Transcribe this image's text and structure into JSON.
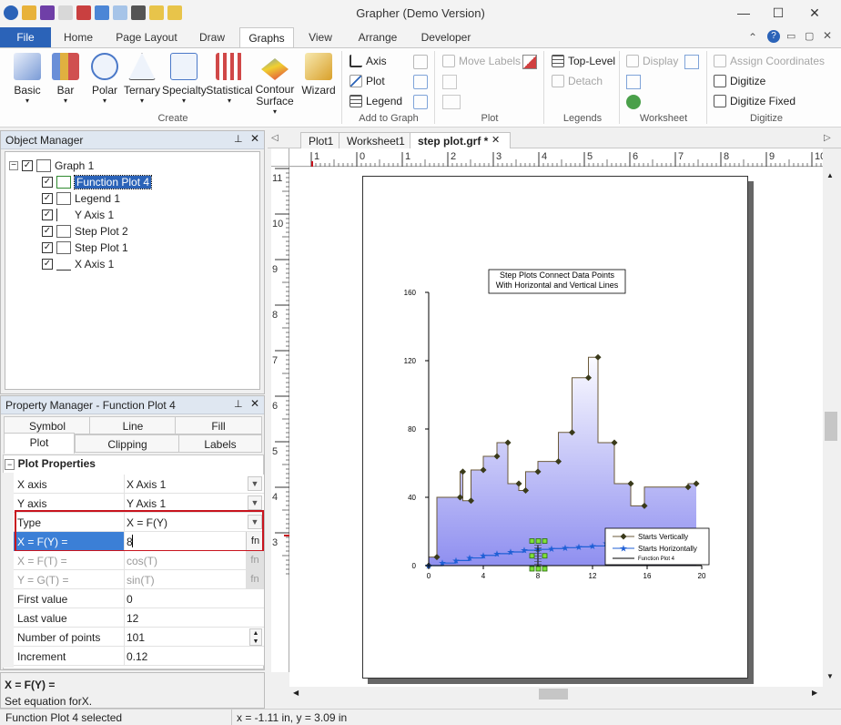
{
  "app": {
    "title": "Grapher (Demo Version)"
  },
  "ribbon_tabs": [
    "File",
    "Home",
    "Page Layout",
    "Draw",
    "Graphs",
    "View",
    "Arrange",
    "Developer"
  ],
  "ribbon": {
    "create": {
      "group": "Create",
      "buttons": [
        "Basic",
        "Bar",
        "Polar",
        "Ternary",
        "Specialty",
        "Statistical",
        "Contour Surface",
        "Wizard"
      ]
    },
    "add_to_graph": {
      "group": "Add to Graph",
      "items": [
        "Axis",
        "Plot",
        "Legend"
      ]
    },
    "plot": {
      "group": "Plot",
      "move_labels": "Move Labels"
    },
    "legends": {
      "group": "Legends",
      "top_level": "Top-Level",
      "detach": "Detach"
    },
    "worksheet": {
      "group": "Worksheet",
      "display": "Display"
    },
    "digitize": {
      "group": "Digitize",
      "assign": "Assign Coordinates",
      "digitize": "Digitize",
      "digitize_fixed": "Digitize Fixed"
    }
  },
  "object_manager": {
    "title": "Object Manager",
    "items": [
      "Graph 1",
      "Function Plot 4",
      "Legend 1",
      "Y Axis 1",
      "Step Plot 2",
      "Step Plot 1",
      "X Axis 1"
    ]
  },
  "property_manager": {
    "title": "Property Manager - Function Plot 4",
    "tabs": [
      "Symbol",
      "Line",
      "Fill",
      "Plot",
      "Clipping",
      "Labels"
    ],
    "section": "Plot Properties",
    "rows": [
      {
        "k": "X axis",
        "v": "X Axis 1"
      },
      {
        "k": "Y axis",
        "v": "Y Axis 1"
      },
      {
        "k": "Type",
        "v": "X = F(Y)"
      },
      {
        "k": "X = F(Y) =",
        "v": "8"
      },
      {
        "k": "X = F(T) =",
        "v": "cos(T)"
      },
      {
        "k": "Y = G(T) =",
        "v": "sin(T)"
      },
      {
        "k": "First value",
        "v": "0"
      },
      {
        "k": "Last value",
        "v": "12"
      },
      {
        "k": "Number of points",
        "v": "101"
      },
      {
        "k": "Increment",
        "v": "0.12"
      }
    ],
    "fn": "fn",
    "desc_title": "X = F(Y) =",
    "desc_text": "Set equation forX."
  },
  "doc_tabs": [
    "Plot1",
    "Worksheet1",
    "step plot.grf *"
  ],
  "ruler_h": [
    "1",
    "0",
    "1",
    "2",
    "3",
    "4",
    "5",
    "6",
    "7",
    "8",
    "9",
    "10"
  ],
  "ruler_v": [
    "11",
    "10",
    "9",
    "8",
    "7",
    "6",
    "5",
    "4",
    "3"
  ],
  "chart_data": {
    "type": "line",
    "title": "Step Plots Connect Data Points\nWith Horizontal and Vertical Lines",
    "title_lines": [
      "Step Plots Connect Data Points",
      "With Horizontal and Vertical Lines"
    ],
    "xlim": [
      0,
      20
    ],
    "ylim": [
      0,
      160
    ],
    "xticks": [
      0,
      4,
      8,
      12,
      16,
      20
    ],
    "yticks": [
      0,
      40,
      80,
      120,
      160
    ],
    "series": [
      {
        "name": "Starts Vertically",
        "x": [
          0,
          0.6,
          2.3,
          2.5,
          3.1,
          4,
          5,
          5.8,
          6.6,
          7.1,
          8,
          9.5,
          10.5,
          11.7,
          12.4,
          13.6,
          14.8,
          15.8,
          19,
          19.6
        ],
        "y": [
          0,
          5,
          40,
          55,
          38,
          56,
          64,
          72,
          48,
          44,
          55,
          61,
          78,
          110,
          122,
          72,
          48,
          35,
          46,
          48
        ]
      },
      {
        "name": "Starts Horizontally",
        "x": [
          0,
          1,
          2,
          3,
          4,
          5,
          6,
          7,
          8,
          9,
          10,
          11,
          12,
          13
        ],
        "y": [
          0,
          1.5,
          3,
          4.5,
          6,
          7,
          8,
          9,
          9.5,
          10,
          10.5,
          11,
          11.5,
          13
        ]
      },
      {
        "name": "Function Plot 4",
        "x": [
          8,
          8
        ],
        "y": [
          0,
          12
        ]
      }
    ],
    "legend_entries": [
      "Starts Vertically",
      "Starts Horizontally",
      "Function Plot 4"
    ]
  },
  "status": {
    "selected": "Function Plot 4 selected",
    "coords": "x = -1.11 in, y = 3.09 in"
  }
}
